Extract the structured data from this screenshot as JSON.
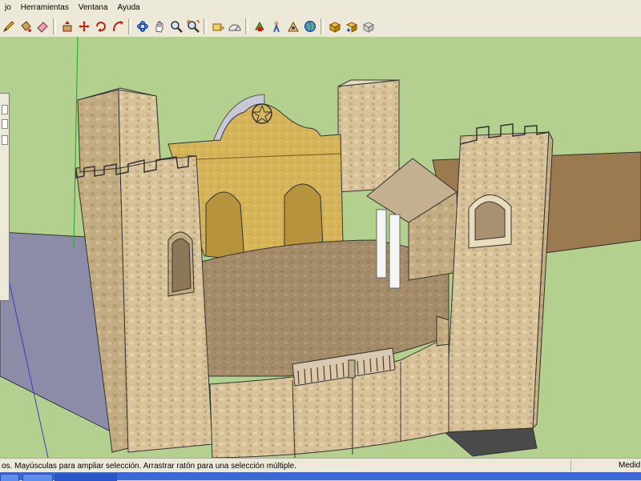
{
  "menu": {
    "items": [
      {
        "label": "jo"
      },
      {
        "label": "Herramientas"
      },
      {
        "label": "Ventana"
      },
      {
        "label": "Ayuda"
      }
    ]
  },
  "toolbar": {
    "groups": [
      [
        "pencil-icon",
        "paint-bucket-icon",
        "eraser-icon"
      ],
      [
        "push-pull-icon",
        "move-icon",
        "rotate-icon",
        "follow-me-icon"
      ],
      [
        "orbit-icon",
        "pan-icon",
        "zoom-icon",
        "zoom-extents-icon"
      ],
      [
        "tape-measure-icon",
        "protractor-icon"
      ],
      [
        "walk-icon",
        "position-camera-icon",
        "look-around-icon",
        "globe-icon"
      ],
      [
        "components-icon",
        "get-models-icon",
        "share-model-icon"
      ]
    ]
  },
  "status": {
    "text": "os. Mayúsculas para ampliar selección. Arrastrar ratón para una selección múltiple.",
    "measure_label": "Medid"
  },
  "colors": {
    "sky": "#b3d08f",
    "stone": "#d8c29a",
    "facade": "#d6b45a",
    "floor": "#a48c6a",
    "ground_plane": "#8c8ca8",
    "brown_plane": "#9c7a4f"
  }
}
